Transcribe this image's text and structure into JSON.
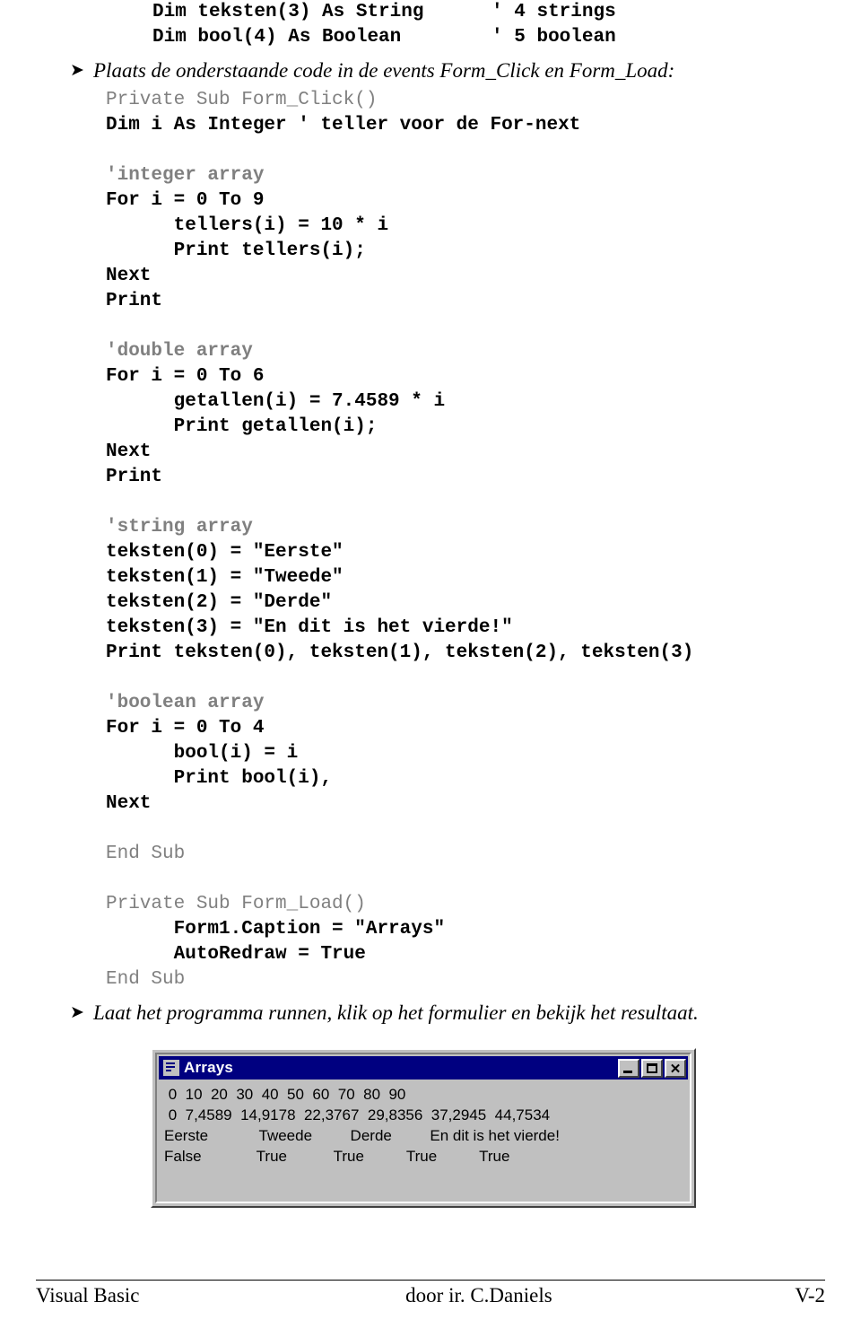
{
  "document": {
    "top_code": [
      "Dim teksten(3) As String      ' 4 strings",
      "Dim bool(4) As Boolean        ' 5 boolean"
    ],
    "instruction_1": "Plaats de onderstaande code in de events Form_Click en Form_Load:",
    "instruction_2": "Laat het programma runnen, klik op het formulier en bekijk het resultaat.",
    "bullet_glyph": "➤",
    "code_block": [
      {
        "text": "Private Sub Form_Click()",
        "style": "grey"
      },
      {
        "text": "Dim i As Integer ' teller voor de For-next",
        "style": "black"
      },
      {
        "text": "",
        "style": "blank"
      },
      {
        "text": "'integer array",
        "style": "grey-bold"
      },
      {
        "text": "For i = 0 To 9",
        "style": "black"
      },
      {
        "text": "      tellers(i) = 10 * i",
        "style": "black"
      },
      {
        "text": "      Print tellers(i);",
        "style": "black"
      },
      {
        "text": "Next",
        "style": "black"
      },
      {
        "text": "Print",
        "style": "black"
      },
      {
        "text": "",
        "style": "blank"
      },
      {
        "text": "'double array",
        "style": "grey-bold"
      },
      {
        "text": "For i = 0 To 6",
        "style": "black"
      },
      {
        "text": "      getallen(i) = 7.4589 * i",
        "style": "black"
      },
      {
        "text": "      Print getallen(i);",
        "style": "black"
      },
      {
        "text": "Next",
        "style": "black"
      },
      {
        "text": "Print",
        "style": "black"
      },
      {
        "text": "",
        "style": "blank"
      },
      {
        "text": "'string array",
        "style": "grey-bold"
      },
      {
        "text": "teksten(0) = \"Eerste\"",
        "style": "black"
      },
      {
        "text": "teksten(1) = \"Tweede\"",
        "style": "black"
      },
      {
        "text": "teksten(2) = \"Derde\"",
        "style": "black"
      },
      {
        "text": "teksten(3) = \"En dit is het vierde!\"",
        "style": "black"
      },
      {
        "text": "Print teksten(0), teksten(1), teksten(2), teksten(3)",
        "style": "black"
      },
      {
        "text": "",
        "style": "blank"
      },
      {
        "text": "'boolean array",
        "style": "grey-bold"
      },
      {
        "text": "For i = 0 To 4",
        "style": "black"
      },
      {
        "text": "      bool(i) = i",
        "style": "black"
      },
      {
        "text": "      Print bool(i),",
        "style": "black"
      },
      {
        "text": "Next",
        "style": "black"
      },
      {
        "text": "",
        "style": "blank"
      },
      {
        "text": "End Sub",
        "style": "grey"
      },
      {
        "text": "",
        "style": "blank"
      },
      {
        "text": "Private Sub Form_Load()",
        "style": "grey"
      },
      {
        "text": "      Form1.Caption = \"Arrays\"",
        "style": "black"
      },
      {
        "text": "      AutoRedraw = True",
        "style": "black"
      },
      {
        "text": "End Sub",
        "style": "grey"
      }
    ]
  },
  "vb_form": {
    "title": "Arrays",
    "minimize_label": "",
    "maximize_label": "",
    "close_label": "✕",
    "output_lines": [
      " 0  10  20  30  40  50  60  70  80  90",
      " 0  7,4589  14,9178  22,3767  29,8356  37,2945  44,7534",
      "Eerste            Tweede         Derde         En dit is het vierde!",
      "False             True           True          True          True"
    ]
  },
  "footer": {
    "left": "Visual Basic",
    "center": "door ir. C.Daniels",
    "right": "V-2"
  }
}
